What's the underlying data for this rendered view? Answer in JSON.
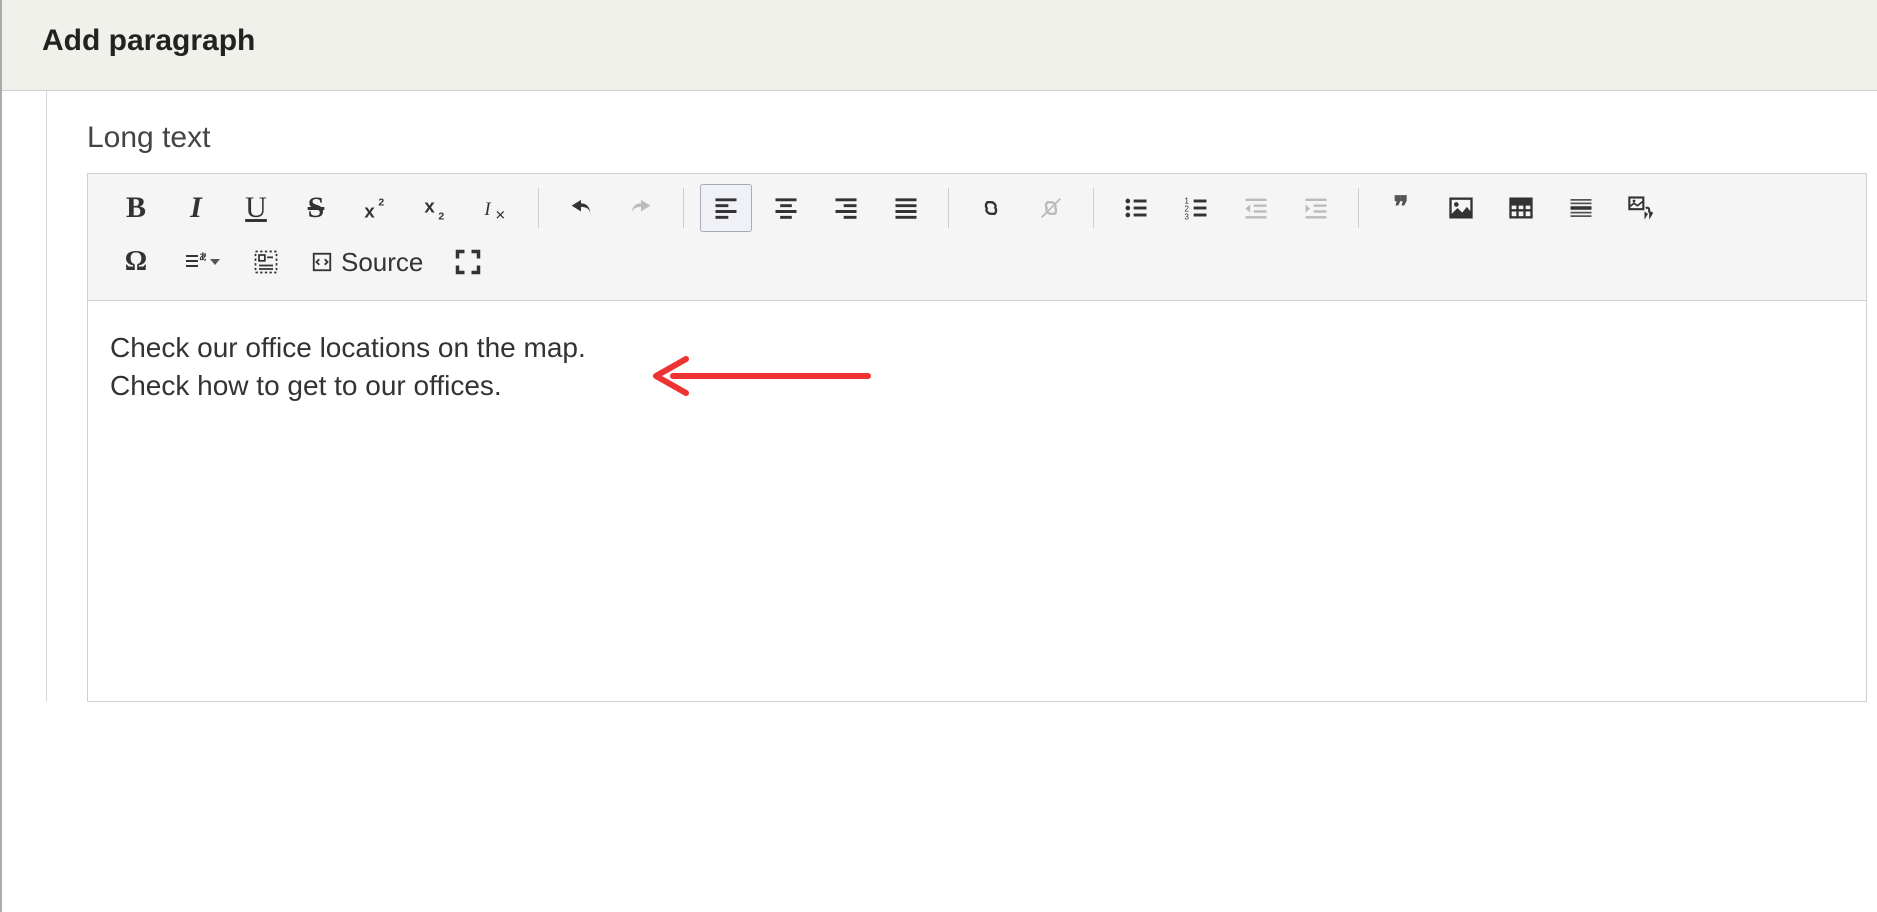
{
  "header": {
    "title": "Add paragraph"
  },
  "field": {
    "label": "Long text"
  },
  "toolbar": {
    "source_label": "Source"
  },
  "content": {
    "line1": "Check our office locations on the map.",
    "line2": "Check how to get to our offices."
  }
}
